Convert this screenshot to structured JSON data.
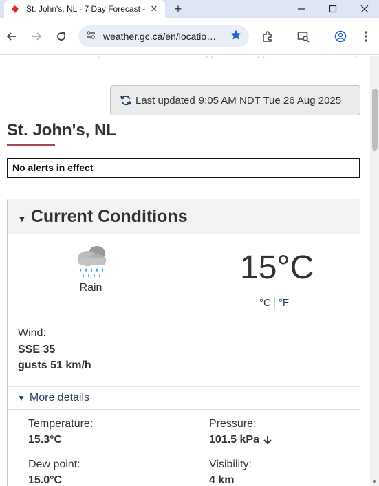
{
  "browser": {
    "tab_title": "St. John's, NL - 7 Day Forecast -",
    "url": "weather.gc.ca/en/locatio…"
  },
  "page": {
    "last_updated_label": "Last updated",
    "last_updated_value": "9:05 AM NDT Tue 26 Aug 2025",
    "city": "St. John's, NL",
    "alerts": "No alerts in effect"
  },
  "current": {
    "heading": "Current Conditions",
    "condition": "Rain",
    "condition_icon": "rain-cloud-icon",
    "temperature": "15°C",
    "unit_c": "°C",
    "unit_f": "°F",
    "wind_label": "Wind:",
    "wind_dir": "SSE 35",
    "wind_gust": "gusts 51 km/h",
    "more_details": "More details",
    "details": {
      "temperature_label": "Temperature:",
      "temperature_value": "15.3°C",
      "pressure_label": "Pressure:",
      "pressure_value": "101.5 kPa",
      "pressure_trend_icon": "arrow-down-icon",
      "dewpoint_label": "Dew point:",
      "dewpoint_value": "15.0°C",
      "visibility_label": "Visibility:",
      "visibility_value": "4 km"
    }
  },
  "colors": {
    "accent_underline": "#a6464f",
    "link": "#284162",
    "tabstrip": "#dfe6f3",
    "omnibox": "#e9eef6"
  }
}
